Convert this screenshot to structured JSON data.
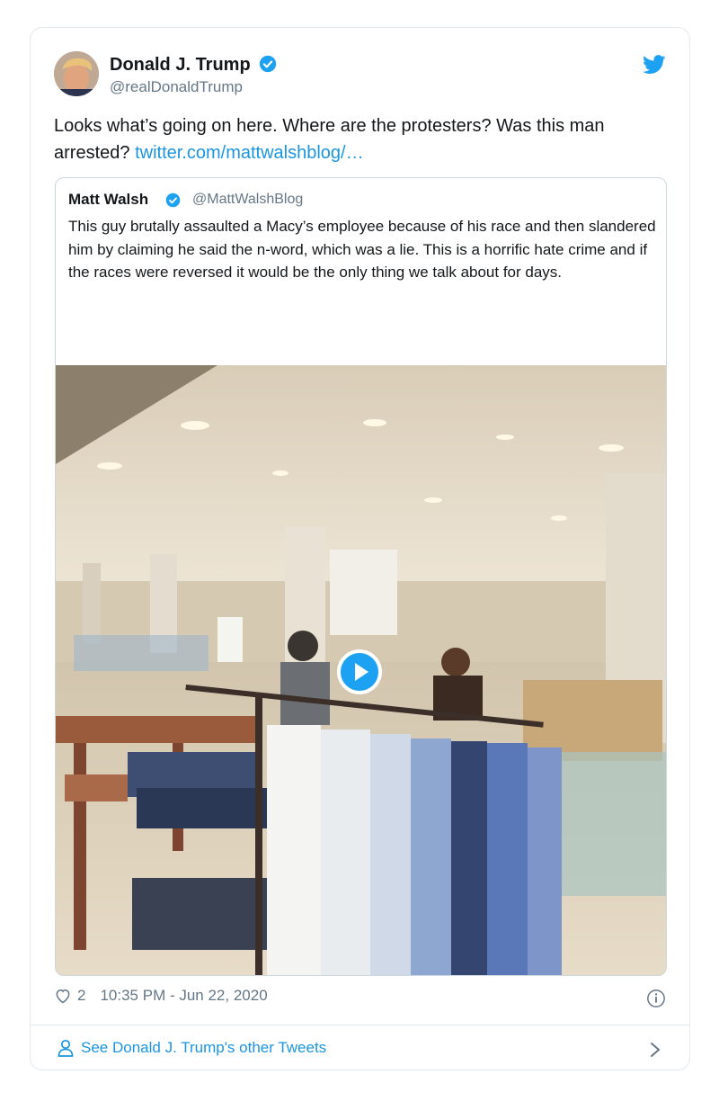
{
  "tweet": {
    "author_name": "Donald J. Trump",
    "author_handle": "@realDonaldTrump",
    "text": "Looks what’s going on here. Where are the protesters? Was this man arrested? ",
    "link": "twitter.com/mattwalshblog/…",
    "likes": "2",
    "timestamp": "10:35 PM - Jun 22, 2020"
  },
  "quoted": {
    "author_name": "Matt Walsh",
    "author_handle": "@MattWalshBlog",
    "text": "This guy brutally assaulted a Macy’s employee because of his race and then slandered him by claiming he said the n-word, which was a lie. This is a horrific hate crime and if the races were reversed it would be the only thing we talk about for days."
  },
  "footer": {
    "more_tweets_label": "See Donald J. Trump's other Tweets"
  },
  "icons": {
    "verified": "verified-badge-icon",
    "twitter": "twitter-bird-icon",
    "like": "heart-icon",
    "info": "info-icon",
    "profile": "person-icon",
    "chevron": "chevron-right-icon",
    "play": "play-icon"
  },
  "colors": {
    "accent": "#1da1f2",
    "link": "#1b95e0",
    "secondary_text": "#657786",
    "border": "#e1e8ed"
  }
}
